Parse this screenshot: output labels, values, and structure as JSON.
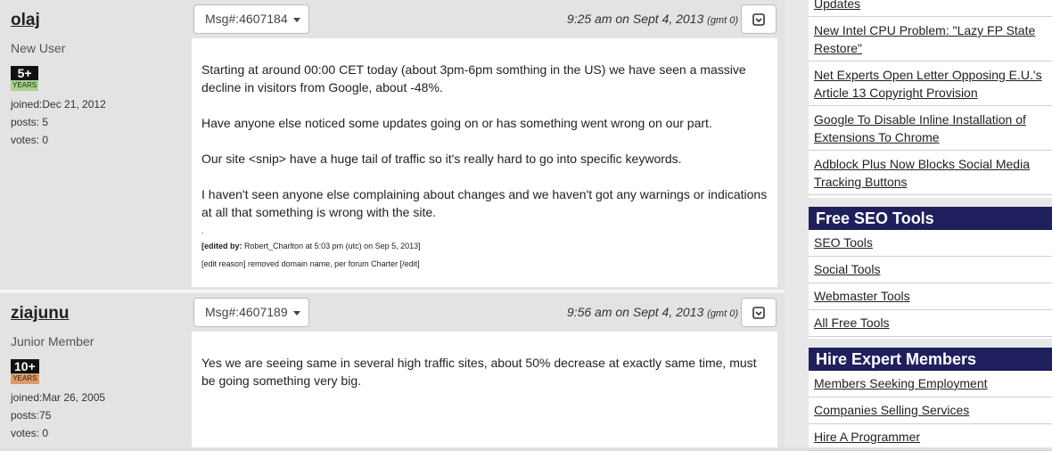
{
  "posts": [
    {
      "username": "olaj",
      "rank": "New User",
      "years": "5+",
      "years_label": "YEARS",
      "joined": "joined:Dec 21, 2012",
      "posts": "posts: 5",
      "votes": "votes: 0",
      "msg": "Msg#:4607184",
      "time": "9:25 am on Sept 4, 2013",
      "tz": "(gmt 0)",
      "body": [
        "Starting at around 00:00 CET today (about 3pm-6pm somthing in the US) we have seen a massive decline in visitors from Google, about -48%.",
        "Have anyone else noticed some updates going on or has something went wrong on our part.",
        "Our site <snip> have a huge tail of traffic so it's really hard to go into specific keywords.",
        "I haven't seen anyone else complaining about changes and we haven't got any warnings or indications at all that something is wrong with the site."
      ],
      "dot": ".",
      "edited_by_label": "[edited by:",
      "edited_by_rest": "Robert_Charlton at 5:03 pm (utc) on Sep 5, 2013]",
      "edit_reason": "[edit reason] removed domain name, per forum Charter [/edit]"
    },
    {
      "username": "ziajunu",
      "rank": "Junior Member",
      "years": "10+",
      "years_label": "YEARS",
      "joined": "joined:Mar 26, 2005",
      "posts": "posts:75",
      "votes": "votes: 0",
      "msg": "Msg#:4607189",
      "time": "9:56 am on Sept 4, 2013",
      "tz": "(gmt 0)",
      "body": [
        "Yes we are seeing same in several high traffic sites, about 50% decrease at exactly same time, must be going something very big."
      ]
    }
  ],
  "sidebar": {
    "news": [
      "Updates",
      "New Intel CPU Problem: \"Lazy FP State Restore\"",
      "Net Experts Open Letter Opposing E.U.'s Article 13 Copyright Provision",
      "Google To Disable Inline Installation of Extensions To Chrome",
      "Adblock Plus Now Blocks Social Media Tracking Buttons"
    ],
    "tools_title": "Free SEO Tools",
    "tools": [
      "SEO Tools",
      "Social Tools",
      "Webmaster Tools",
      "All Free Tools"
    ],
    "hire_title": "Hire Expert Members",
    "hire": [
      "Members Seeking Employment",
      "Companies Selling Services",
      "Hire A Programmer"
    ]
  },
  "colors": {
    "sidebar_header": "#1f1f5e",
    "years_5": "#a6d48a",
    "years_10": "#e09a6a"
  },
  "icons": [
    "caret-down-icon",
    "collapse-icon"
  ]
}
